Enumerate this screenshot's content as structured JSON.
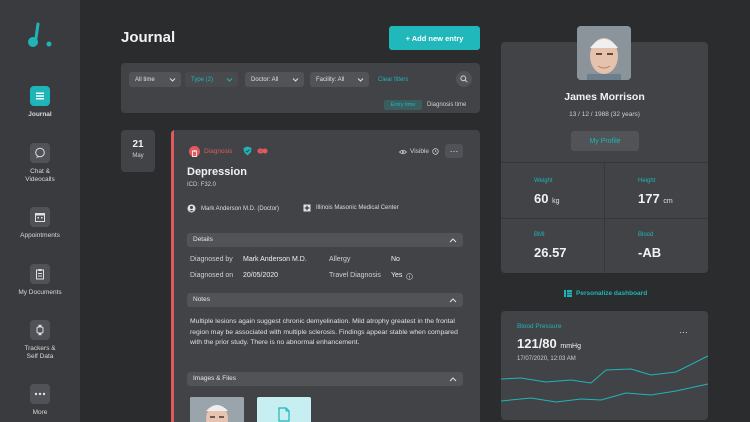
{
  "sidebar": {
    "items": [
      {
        "label": "Journal",
        "icon": "journal-icon",
        "active": true
      },
      {
        "label": "Chat &\nVideocalls",
        "icon": "chat-icon"
      },
      {
        "label": "Appointments",
        "icon": "calendar-icon"
      },
      {
        "label": "My Documents",
        "icon": "documents-icon"
      },
      {
        "label": "Trackers &\nSelf Data",
        "icon": "tracker-icon"
      },
      {
        "label": "More",
        "icon": "more-icon"
      }
    ]
  },
  "header": {
    "title": "Journal",
    "add_label": "+ Add new entry"
  },
  "filters": {
    "time": "All time",
    "type": "Type (2)",
    "doctor": "Doctor: All",
    "facility": "Facility: All",
    "clear": "Clear filters",
    "sort_entry": "Entry time",
    "sort_diagnosis": "Diagnosis time"
  },
  "entry": {
    "day": "21",
    "month": "May",
    "type_label": "Diagnosis",
    "visibility": "Visible",
    "title": "Depression",
    "icd": "ICD: F32.0",
    "doctor": "Mark Anderson M.D. (Doctor)",
    "facility": "Illinois Masonic Medical Center",
    "details_header": "Details",
    "details": {
      "diagnosed_by_label": "Diagnosed by",
      "diagnosed_by": "Mark Anderson M.D.",
      "diagnosed_on_label": "Diagnosed on",
      "diagnosed_on": "20/05/2020",
      "allergy_label": "Allergy",
      "allergy": "No",
      "travel_label": "Travel Diagnosis",
      "travel": "Yes"
    },
    "notes_header": "Notes",
    "notes": "Multiple lesions again suggest chronic demyelination. Mild atrophy greatest in the frontal region may be associated with multiple sclerosis. Findings appear stable when compared with the prior study. There is no abnormal enhancement.",
    "files_header": "Images & Files"
  },
  "profile": {
    "name": "James Morrison",
    "dob": "13 / 12 / 1988 (32 years)",
    "button": "My Profile",
    "weight_label": "Weight",
    "weight": "60",
    "weight_unit": "kg",
    "height_label": "Height",
    "height": "177",
    "height_unit": "cm",
    "bmi_label": "BMI",
    "bmi": "26.57",
    "blood_label": "Blood",
    "blood": "-AB"
  },
  "personalize": "Personalize dashboard",
  "bp": {
    "label": "Blood Pressure",
    "value": "121/80",
    "unit": "mmHg",
    "timestamp": "17/07/2020, 12:03 AM"
  },
  "colors": {
    "accent": "#1fb5b8",
    "alert": "#e05a5f",
    "panel": "#424347",
    "bg": "#2b2c2e"
  }
}
